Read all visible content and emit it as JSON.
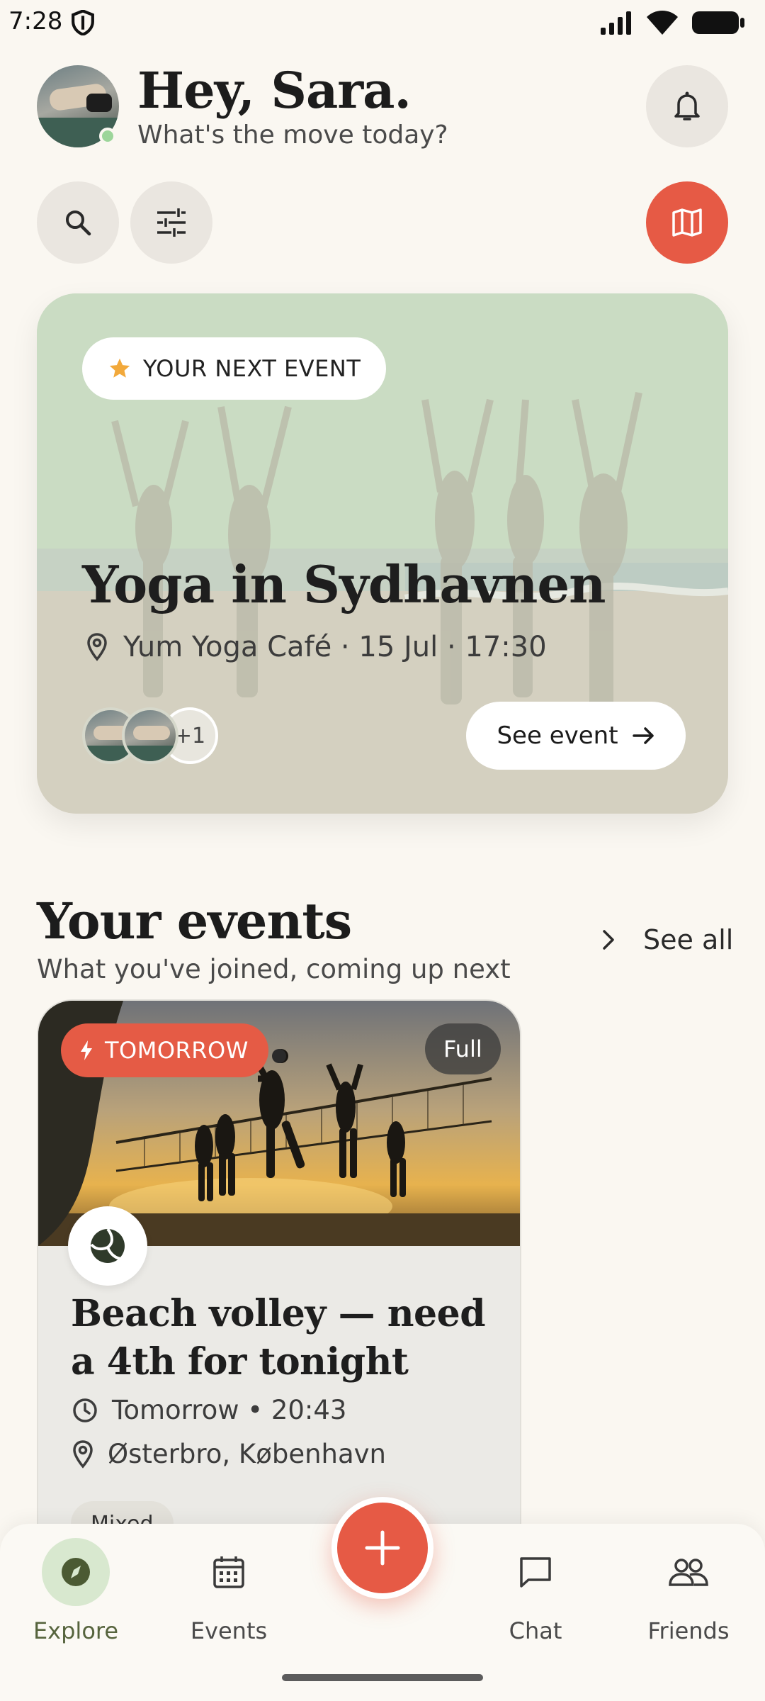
{
  "status_bar": {
    "time": "7:28"
  },
  "header": {
    "greeting": "Hey, Sara.",
    "subtitle": "What's the move today?"
  },
  "next_event": {
    "badge": "YOUR NEXT EVENT",
    "title": "Yoga in Sydhavnen",
    "meta": "Yum Yoga Café · 15 Jul · 17:30",
    "extra_attendees": "+1",
    "button": "See event"
  },
  "your_events": {
    "title": "Your events",
    "subtitle": "What you've joined, coming up next",
    "see_all": "See all",
    "cards": [
      {
        "badge": "TOMORROW",
        "status": "Full",
        "title": "Beach volley — need a 4th for tonight",
        "time": "Tomorrow • 20:43",
        "location": "Østerbro, København",
        "tag": "Mixed"
      }
    ]
  },
  "nav": {
    "items": [
      {
        "label": "Explore",
        "icon": "compass-icon",
        "active": true
      },
      {
        "label": "Events",
        "icon": "calendar-icon",
        "active": false
      },
      {
        "label": "Chat",
        "icon": "chat-icon",
        "active": false
      },
      {
        "label": "Friends",
        "icon": "friends-icon",
        "active": false
      }
    ]
  },
  "colors": {
    "accent": "#E65A45",
    "background": "#FAF7F1",
    "active_nav": "#D8E8CF",
    "star": "#F2A93B"
  }
}
